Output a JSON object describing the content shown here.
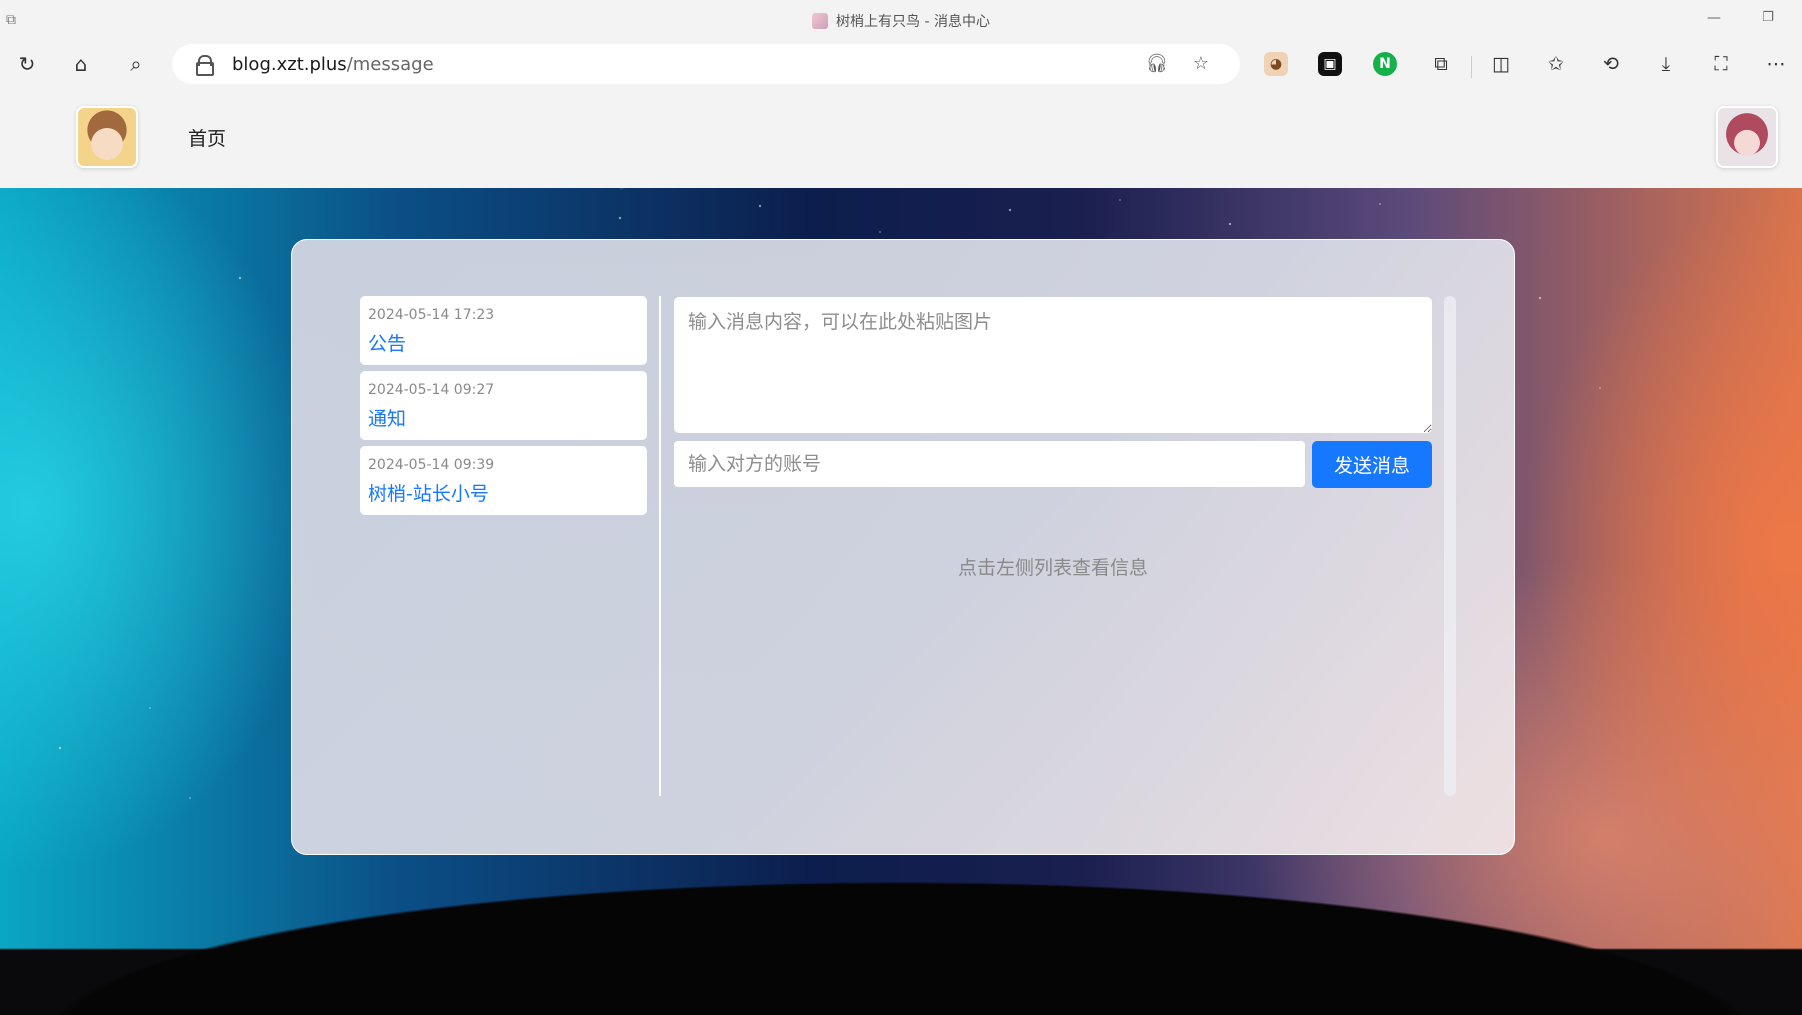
{
  "browser": {
    "window_title": "树梢上有只鸟 - 消息中心",
    "url_host": "blog.xzt.plus",
    "url_path": "/message",
    "icons": {
      "refresh": "refresh-icon",
      "home": "home-icon",
      "search": "search-icon",
      "read_aloud": "headphones-icon",
      "favorite": "star-icon"
    }
  },
  "site": {
    "nav_home": "首页"
  },
  "messages": [
    {
      "time": "2024-05-14 17:23",
      "title": "公告"
    },
    {
      "time": "2024-05-14 09:27",
      "title": "通知"
    },
    {
      "time": "2024-05-14 09:39",
      "title": "树梢-站长小号"
    }
  ],
  "compose": {
    "content_placeholder": "输入消息内容，可以在此处粘贴图片",
    "account_placeholder": "输入对方的账号",
    "send_label": "发送消息",
    "hint": "点击左侧列表查看信息"
  },
  "colors": {
    "accent": "#1677ff"
  }
}
